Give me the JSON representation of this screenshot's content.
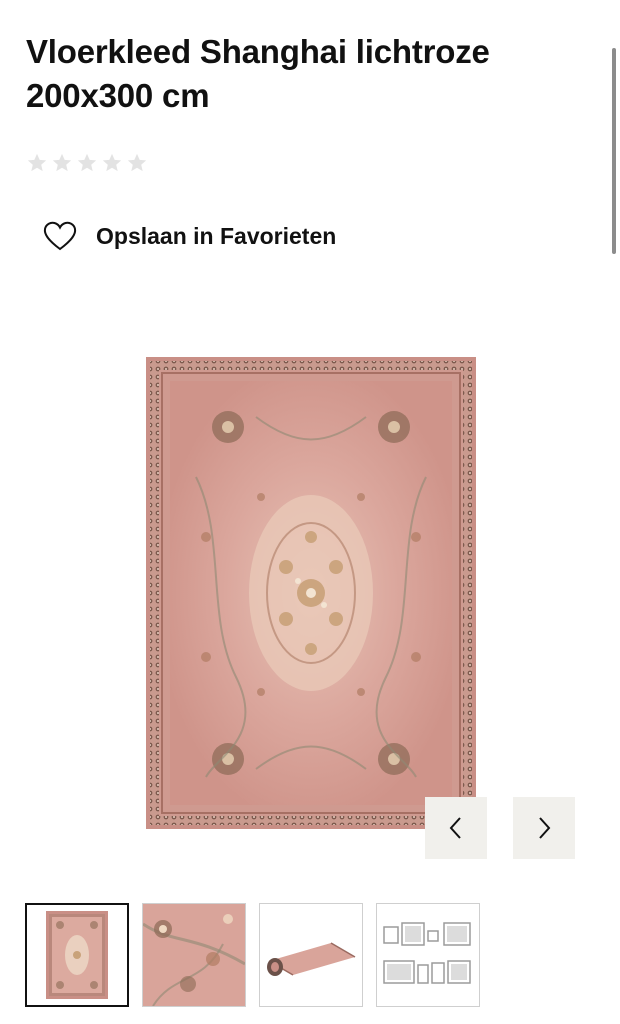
{
  "product": {
    "title": "Vloerkleed Shanghai lichtroze 200x300 cm",
    "rating": {
      "stars_filled": 0,
      "stars_total": 5
    }
  },
  "favorites": {
    "label": "Opslaan in Favorieten",
    "icon": "heart-outline-icon"
  },
  "gallery": {
    "main_image": "rug-shanghai-lichtroze",
    "prev_icon": "chevron-left-icon",
    "next_icon": "chevron-right-icon",
    "thumbnails": [
      {
        "name": "rug-full-view",
        "active": true
      },
      {
        "name": "rug-detail-closeup",
        "active": false
      },
      {
        "name": "rug-rolled-view",
        "active": false
      },
      {
        "name": "room-layout-diagram",
        "active": false
      }
    ]
  },
  "colors": {
    "rug_base": "#d9a7a0",
    "rug_border": "#9a6a60",
    "star_empty": "#e3e3e3",
    "nav_bg": "#f1f0ec",
    "text": "#111111"
  }
}
